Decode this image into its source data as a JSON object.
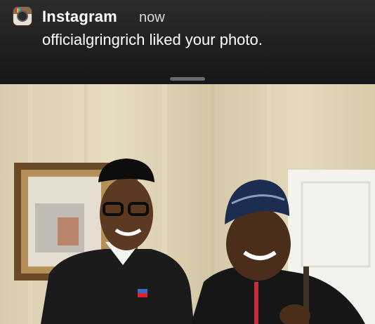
{
  "notification": {
    "app_name": "Instagram",
    "time": "now",
    "message": "officialgringrich liked your photo.",
    "icon": "instagram-icon"
  },
  "photo": {
    "subject": "photo-two-men"
  }
}
